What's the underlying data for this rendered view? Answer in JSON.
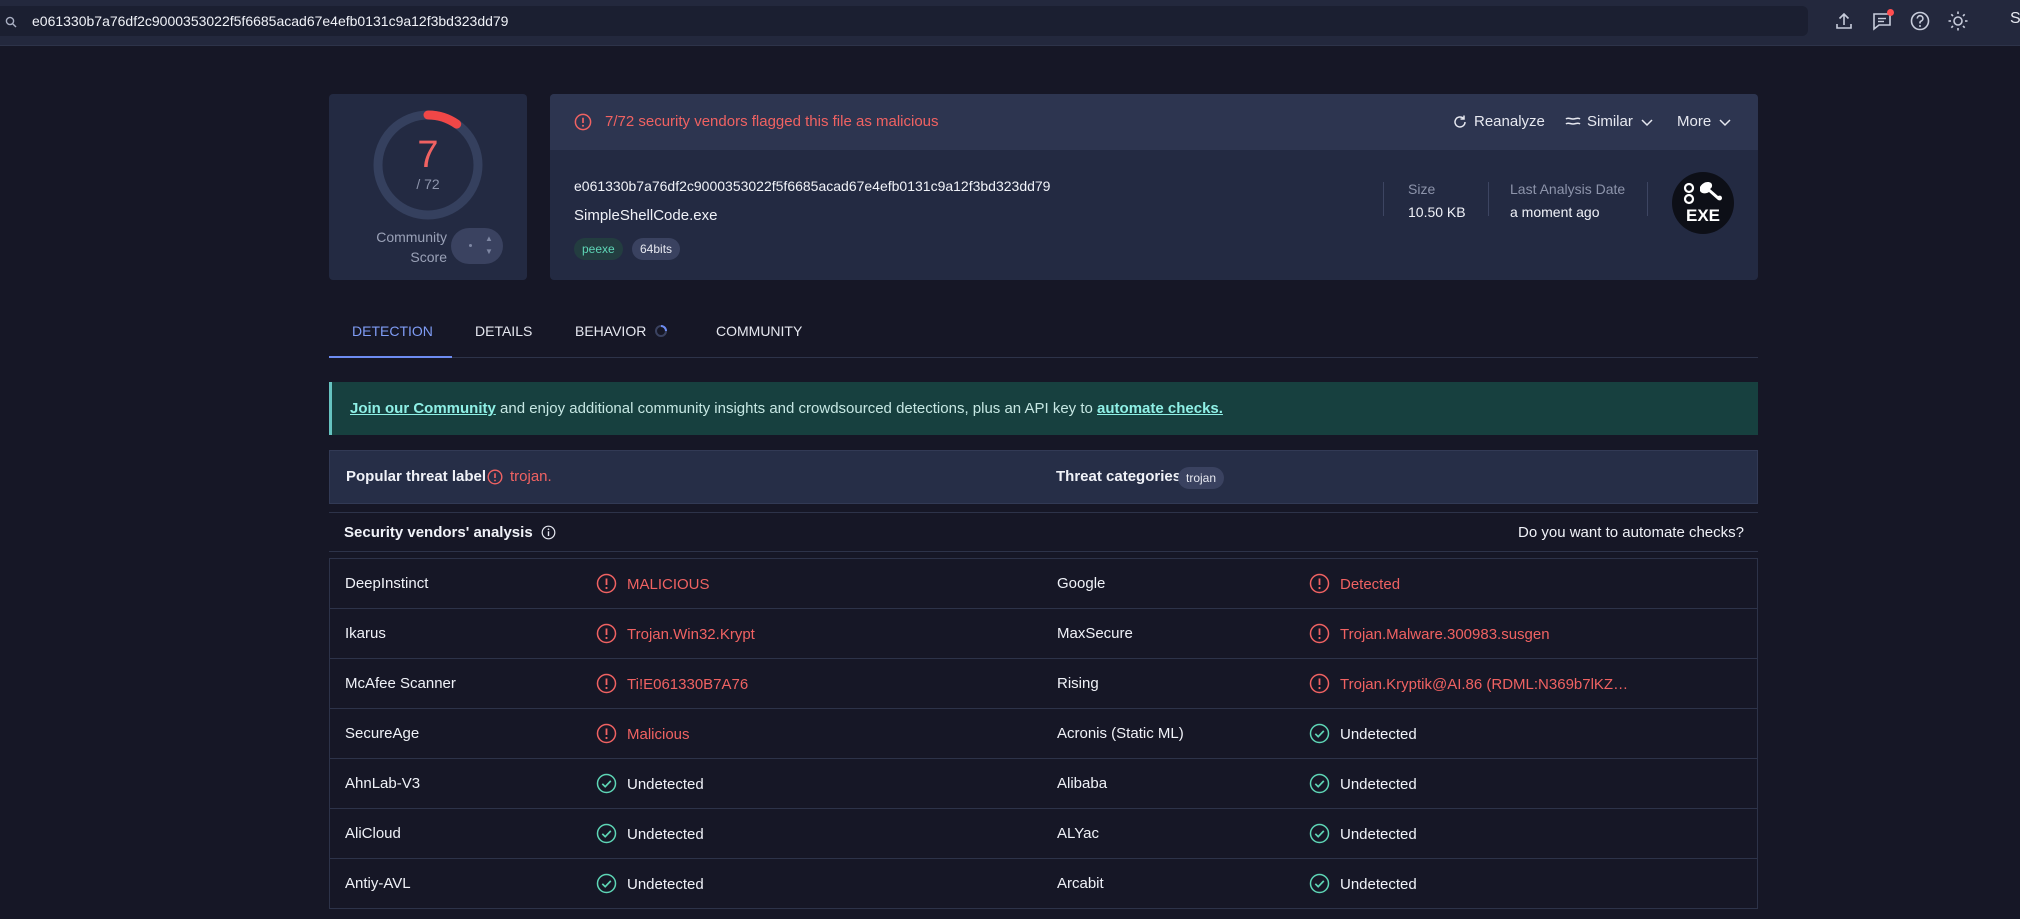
{
  "search": {
    "value": "e061330b7a76df2c9000353022f5f6685acad67e4efb0131c9a12f3bd323dd79"
  },
  "topbar": {
    "avatar_initial": "S"
  },
  "score": {
    "detections": "7",
    "total": "/ 72",
    "community_label": "Community Score",
    "fraction": 0.0972
  },
  "file": {
    "flag_text": "7/72 security vendors flagged this file as malicious",
    "reanalyze": "Reanalyze",
    "similar": "Similar",
    "more": "More",
    "hash": "e061330b7a76df2c9000353022f5f6685acad67e4efb0131c9a12f3bd323dd79",
    "name": "SimpleShellCode.exe",
    "tags": [
      "peexe",
      "64bits"
    ],
    "size_label": "Size",
    "size_value": "10.50 KB",
    "date_label": "Last Analysis Date",
    "date_value": "a moment ago",
    "type_icon_text": "EXE"
  },
  "tabs": [
    {
      "label": "DETECTION",
      "active": true
    },
    {
      "label": "DETAILS"
    },
    {
      "label": "BEHAVIOR"
    },
    {
      "label": "COMMUNITY"
    }
  ],
  "banner": {
    "join_link": "Join our Community",
    "middle": " and enjoy additional community insights and crowdsourced detections, plus an API key to ",
    "automate_link": "automate checks."
  },
  "threat": {
    "popular_label": "Popular threat label",
    "popular_value": "trojan.",
    "categories_label": "Threat categories",
    "category": "trojan"
  },
  "vendors": {
    "title": "Security vendors' analysis",
    "automate_question": "Do you want to automate checks?",
    "rows": [
      [
        {
          "vendor": "DeepInstinct",
          "result": "MALICIOUS",
          "status": "malicious"
        },
        {
          "vendor": "Google",
          "result": "Detected",
          "status": "malicious"
        }
      ],
      [
        {
          "vendor": "Ikarus",
          "result": "Trojan.Win32.Krypt",
          "status": "malicious"
        },
        {
          "vendor": "MaxSecure",
          "result": "Trojan.Malware.300983.susgen",
          "status": "malicious"
        }
      ],
      [
        {
          "vendor": "McAfee Scanner",
          "result": "Ti!E061330B7A76",
          "status": "malicious"
        },
        {
          "vendor": "Rising",
          "result": "Trojan.Kryptik@AI.86 (RDML:N369b7lKZ…",
          "status": "malicious"
        }
      ],
      [
        {
          "vendor": "SecureAge",
          "result": "Malicious",
          "status": "malicious"
        },
        {
          "vendor": "Acronis (Static ML)",
          "result": "Undetected",
          "status": "undetected"
        }
      ],
      [
        {
          "vendor": "AhnLab-V3",
          "result": "Undetected",
          "status": "undetected"
        },
        {
          "vendor": "Alibaba",
          "result": "Undetected",
          "status": "undetected"
        }
      ],
      [
        {
          "vendor": "AliCloud",
          "result": "Undetected",
          "status": "undetected"
        },
        {
          "vendor": "ALYac",
          "result": "Undetected",
          "status": "undetected"
        }
      ],
      [
        {
          "vendor": "Antiy-AVL",
          "result": "Undetected",
          "status": "undetected"
        },
        {
          "vendor": "Arcabit",
          "result": "Undetected",
          "status": "undetected"
        }
      ]
    ]
  },
  "colors": {
    "malicious": "#f06262",
    "clean": "#5ed6b6",
    "accent": "#6d8cf2"
  }
}
